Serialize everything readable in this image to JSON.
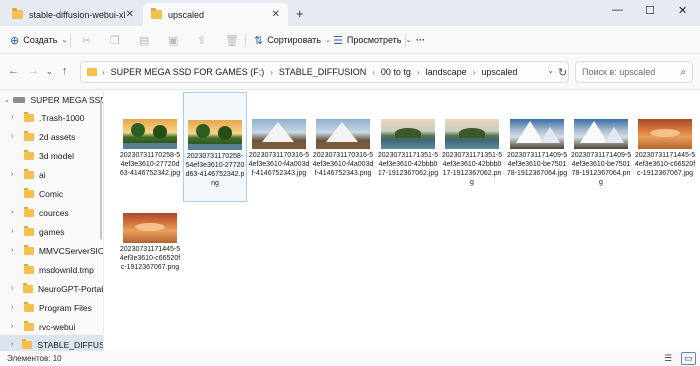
{
  "tabs": [
    {
      "label": "stable-diffusion-webui-xl",
      "active": false
    },
    {
      "label": "upscaled",
      "active": true
    }
  ],
  "tab_close_glyph": "✕",
  "new_tab_glyph": "+",
  "window_controls": {
    "minimize": "—",
    "maximize": "☐",
    "close": "✕"
  },
  "toolbar": {
    "create_label": "Создать",
    "sort_label": "Сортировать",
    "view_label": "Просмотреть",
    "more_label": "···"
  },
  "address": {
    "crumbs": [
      "SUPER MEGA SSD FOR GAMES (F:)",
      "STABLE_DIFFUSION",
      "00 to tg",
      "landscape",
      "upscaled"
    ]
  },
  "search": {
    "placeholder": "Поиск в: upscaled"
  },
  "sidebar": {
    "items": [
      {
        "label": "SUPER MEGA SSD FO",
        "type": "drive",
        "expanded": true
      },
      {
        "label": ".Trash-1000",
        "type": "folder"
      },
      {
        "label": "2d assets",
        "type": "folder"
      },
      {
        "label": "3d model",
        "type": "folder"
      },
      {
        "label": "ai",
        "type": "folder"
      },
      {
        "label": "Comic",
        "type": "folder"
      },
      {
        "label": "cources",
        "type": "folder"
      },
      {
        "label": "games",
        "type": "folder"
      },
      {
        "label": "MMVCServerSIO",
        "type": "folder"
      },
      {
        "label": "msdownld.tmp",
        "type": "folder"
      },
      {
        "label": "NeuroGPT-Portable",
        "type": "folder"
      },
      {
        "label": "Program Files",
        "type": "folder"
      },
      {
        "label": "rvc-webui",
        "type": "folder"
      },
      {
        "label": "STABLE_DIFFUSION",
        "type": "folder",
        "selected": true
      }
    ]
  },
  "files": [
    {
      "name": "20230731170258-54ef3e3610-27720d63-4146752342.jpg",
      "thumb": "palm",
      "selected": false
    },
    {
      "name": "20230731170258-54ef3e3610-27720d63-4146752342.png",
      "thumb": "palm",
      "selected": true
    },
    {
      "name": "20230731170316-54ef3e3610-f4a003df-4146752343.jpg",
      "thumb": "mtn",
      "selected": false
    },
    {
      "name": "20230731170316-54ef3e3610-f4a003df-4146752343.png",
      "thumb": "mtn",
      "selected": false
    },
    {
      "name": "20230731171351-54ef3e3610-42bbb017-1912367062.jpg",
      "thumb": "island",
      "selected": false
    },
    {
      "name": "20230731171351-54ef3e3610-42bbb017-1912367062.png",
      "thumb": "island",
      "selected": false
    },
    {
      "name": "20230731171409-54ef3e3610-be750178-1912367064.jpg",
      "thumb": "snow",
      "selected": false
    },
    {
      "name": "20230731171409-54ef3e3610-be750178-1912367064.png",
      "thumb": "snow",
      "selected": false
    },
    {
      "name": "20230731171445-54ef3e3610-c66520fc-1912367067.jpg",
      "thumb": "desert",
      "selected": false
    },
    {
      "name": "20230731171445-54ef3e3610-c66520fc-1912367067.png",
      "thumb": "desert",
      "selected": false
    }
  ],
  "status": {
    "item_count": "Элементов: 10"
  },
  "colors": {
    "accent": "#2b5fb0",
    "folder": "#f2c14e",
    "selection": "#dbe4ef"
  }
}
